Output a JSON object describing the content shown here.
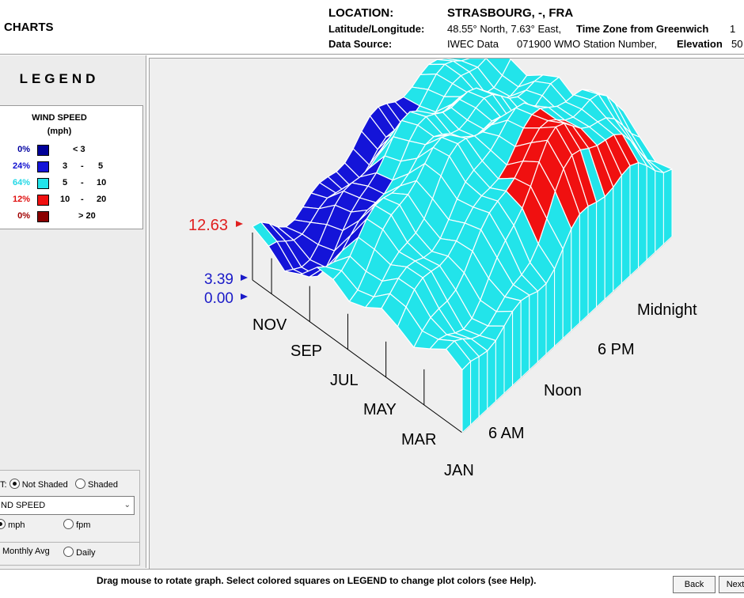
{
  "header": {
    "app_title": "CHARTS",
    "location_label": "LOCATION:",
    "location_value": "STRASBOURG, -, FRA",
    "latlong_label": "Latitude/Longitude:",
    "latlong_value": "48.55° North, 7.63° East,",
    "timezone_label": "Time Zone from Greenwich",
    "timezone_value": "1",
    "source_label": "Data Source:",
    "source_value": "IWEC Data",
    "station_value": "071900 WMO Station Number,",
    "elevation_label": "Elevation",
    "elevation_value": "50"
  },
  "legend": {
    "title": "LEGEND",
    "heading": "WIND SPEED",
    "unit": "(mph)",
    "rows": [
      {
        "pct": "0%",
        "color": "#000099",
        "pct_color": "#0000a0",
        "lo": "< 3",
        "dash": "",
        "hi": ""
      },
      {
        "pct": "24%",
        "color": "#1414d8",
        "pct_color": "#1010d0",
        "lo": "3",
        "dash": "-",
        "hi": "5"
      },
      {
        "pct": "64%",
        "color": "#22e4ea",
        "pct_color": "#22d8e6",
        "lo": "5",
        "dash": "-",
        "hi": "10"
      },
      {
        "pct": "12%",
        "color": "#f01010",
        "pct_color": "#e01010",
        "lo": "10",
        "dash": "-",
        "hi": "20"
      },
      {
        "pct": "0%",
        "color": "#8b0000",
        "pct_color": "#a00000",
        "lo": "> 20",
        "dash": "",
        "hi": ""
      }
    ]
  },
  "controls": {
    "shade_label_fragment": "T:",
    "not_shaded": "Not Shaded",
    "shaded": "Shaded",
    "variable_select": "ND SPEED",
    "unit_mph": "mph",
    "unit_fpm": "fpm",
    "monthly_avg": "Monthly Avg",
    "daily": "Daily"
  },
  "chart_data": {
    "type": "3d-surface",
    "title": "",
    "z_tick_labels": [
      "12.63",
      "3.39",
      "0.00"
    ],
    "z_tick_colors": [
      "#e02020",
      "#1a1ac8",
      "#1a1ac8"
    ],
    "month_labels": [
      "NOV",
      "SEP",
      "JUL",
      "MAY",
      "MAR",
      "JAN"
    ],
    "hour_labels": [
      "Midnight",
      "6 PM",
      "Noon",
      "6 AM"
    ],
    "colors": {
      "band_3_5": "#1414d8",
      "band_5_10": "#22e4ea",
      "band_10_20": "#f01010"
    }
  },
  "footer": {
    "status": "Drag mouse to rotate graph.  Select colored squares on LEGEND to change plot colors (see Help).",
    "back": "Back",
    "next": "Next"
  }
}
